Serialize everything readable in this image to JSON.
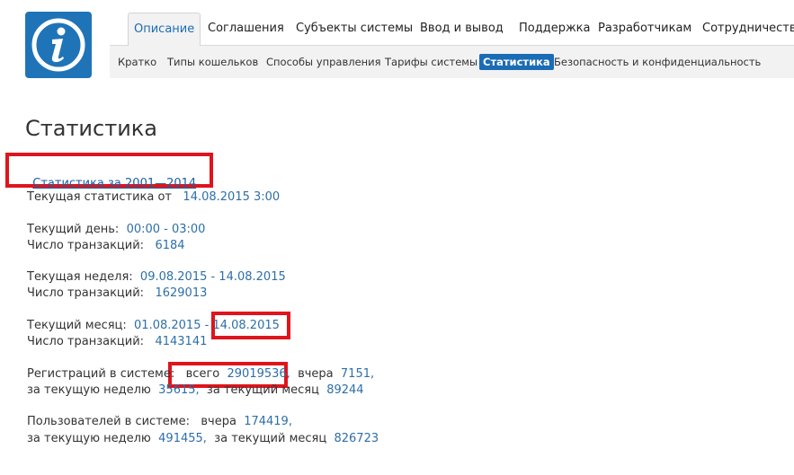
{
  "nav": {
    "tabs": [
      "Описание",
      "Соглашения",
      "Субъекты системы",
      "Ввод и вывод",
      "Поддержка",
      "Разработчикам",
      "Сотрудничество"
    ],
    "active_tab": "Описание",
    "subtabs": [
      "Кратко",
      "Типы кошельков",
      "Способы управления",
      "Тарифы системы",
      "Статистика",
      "Безопасность и конфиденциальность"
    ],
    "active_subtab": "Статистика"
  },
  "page": {
    "title": "Статистика",
    "archive_link": "Статистика за 2001—2014"
  },
  "stats": {
    "current_label": "Текущая статистика от",
    "current_value": "14.08.2015 3:00",
    "day_label": "Текущий день:",
    "day_value": "00:00 - 03:00",
    "day_tx_label": "Число транзакций:",
    "day_tx_value": "6184",
    "week_label": "Текущая неделя:",
    "week_value": "09.08.2015 - 14.08.2015",
    "week_tx_label": "Число транзакций:",
    "week_tx_value": "1629013",
    "month_label": "Текущий месяц:",
    "month_from": "01.08.2015",
    "month_dash": "-",
    "month_to": "14.08.2015",
    "month_tx_label": "Число транзакций:",
    "month_tx_value": "4143141",
    "reg_label": "Регистраций в системе:",
    "reg_total_label": "всего",
    "reg_total_value": "29019536,",
    "reg_yesterday_label": "вчера",
    "reg_yesterday_value": "7151,",
    "reg_week_label": "за текущую неделю",
    "reg_week_value": "35615,",
    "reg_month_label": "за текущий месяц",
    "reg_month_value": "89244",
    "users_label": "Пользователей в системе:",
    "users_yesterday_label": "вчера",
    "users_yesterday_value": "174419,",
    "users_week_label": "за текущую неделю",
    "users_week_value": "491455,",
    "users_month_label": "за текущий месяц",
    "users_month_value": "826723"
  },
  "icons": {
    "logo": "info-icon"
  },
  "colors": {
    "accent": "#1b6cb5",
    "value": "#2d6fa8",
    "highlight": "#e0141c"
  }
}
